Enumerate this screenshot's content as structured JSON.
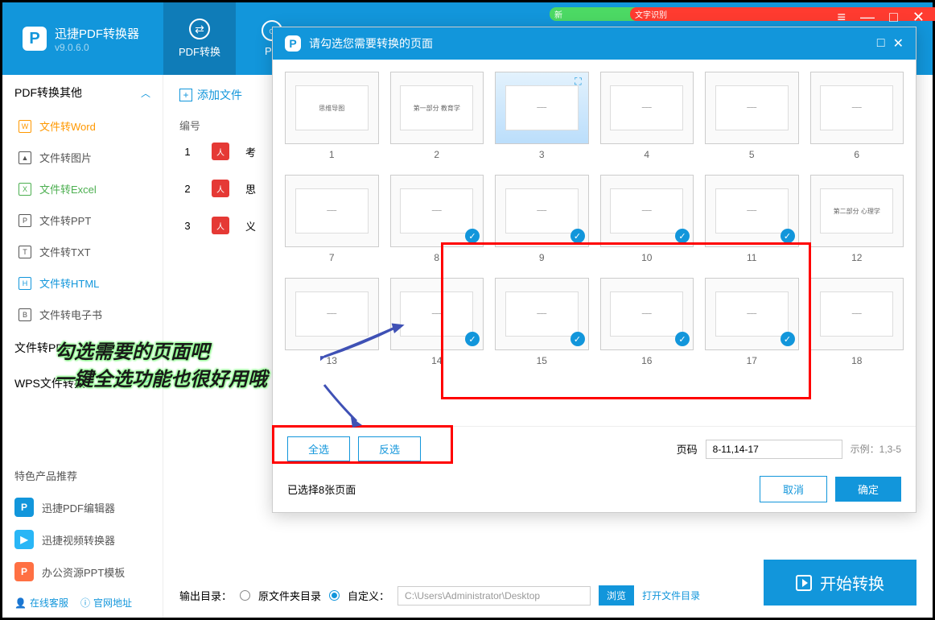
{
  "app": {
    "name": "迅捷PDF转换器",
    "version": "v9.0.6.0"
  },
  "top_tabs": [
    {
      "label": "PDF转换",
      "badge": ""
    },
    {
      "label": "PD",
      "badge": ""
    }
  ],
  "badges": {
    "new": "新",
    "ocr": "文字识别"
  },
  "sidebar": {
    "section1": "PDF转换其他",
    "items": [
      {
        "label": "文件转Word",
        "active": false
      },
      {
        "label": "文件转图片",
        "active": false
      },
      {
        "label": "文件转Excel",
        "active": true
      },
      {
        "label": "文件转PPT",
        "active": false
      },
      {
        "label": "文件转TXT",
        "active": false
      },
      {
        "label": "文件转HTML",
        "active": true
      },
      {
        "label": "文件转电子书",
        "active": false
      }
    ],
    "section2": "文件转PDF",
    "section3": "WPS文件转换",
    "recommend_title": "特色产品推荐",
    "recommend": [
      {
        "label": "迅捷PDF编辑器",
        "color": "#1296db"
      },
      {
        "label": "迅捷视频转换器",
        "color": "#29b6f6"
      },
      {
        "label": "办公资源PPT模板",
        "color": "#ff7043"
      }
    ],
    "bottom": {
      "service": "在线客服",
      "site": "官网地址"
    }
  },
  "content": {
    "add_file": "添加文件",
    "col_num": "编号",
    "files": [
      {
        "num": "1",
        "name": "考"
      },
      {
        "num": "2",
        "name": "思"
      },
      {
        "num": "3",
        "name": "义"
      }
    ],
    "output_label": "输出目录：",
    "radio1": "原文件夹目录",
    "radio2": "自定义：",
    "path": "C:\\Users\\Administrator\\Desktop",
    "browse": "浏览",
    "open_dir": "打开文件目录",
    "start": "开始转换"
  },
  "modal": {
    "title": "请勾选您需要转换的页面",
    "pages": [
      1,
      2,
      3,
      4,
      5,
      6,
      7,
      8,
      9,
      10,
      11,
      12,
      13,
      14,
      15,
      16,
      17,
      18
    ],
    "selected": [
      8,
      9,
      10,
      11,
      14,
      15,
      16,
      17
    ],
    "hover_page": 3,
    "thumb_titles": {
      "1": "思维导图",
      "2": "第一部分 教育学",
      "12": "第二部分 心理学"
    },
    "select_all": "全选",
    "invert": "反选",
    "range_label": "页码",
    "range_value": "8-11,14-17",
    "example": "示例：1,3-5",
    "selected_text": "已选择8张页面",
    "cancel": "取消",
    "confirm": "确定"
  },
  "annotation": {
    "line1": "勾选需要的页面吧",
    "line2": "一键全选功能也很好用哦"
  }
}
